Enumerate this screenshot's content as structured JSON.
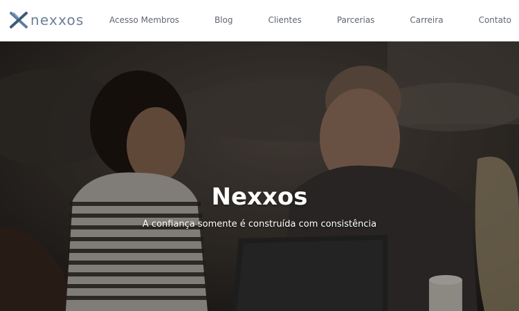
{
  "header": {
    "logo_text": "nexxos",
    "nav": [
      {
        "label": "Acesso Membros"
      },
      {
        "label": "Blog"
      },
      {
        "label": "Clientes"
      },
      {
        "label": "Parcerias"
      },
      {
        "label": "Carreira"
      },
      {
        "label": "Contato"
      }
    ]
  },
  "hero": {
    "title": "Nexxos",
    "subtitle": "A confiança somente é construída com consistência"
  },
  "colors": {
    "logo_accent": "#3d5a7a",
    "logo_text": "#6b7f95",
    "nav_text": "#5f6670",
    "hero_text": "#ffffff"
  }
}
